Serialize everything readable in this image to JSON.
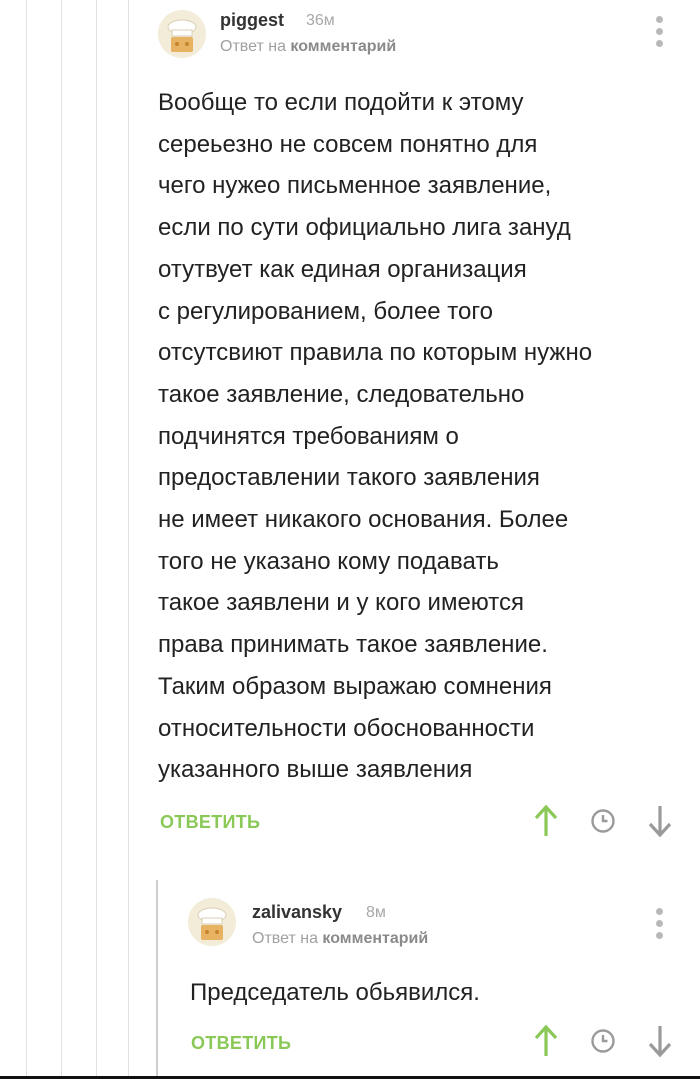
{
  "comments": [
    {
      "author": "piggest",
      "time": "36м",
      "reply_prefix": "Ответ на",
      "reply_target": "комментарий",
      "text": "Вообще то если подойти к этому\nсереьезно не совсем понятно для\nчего нужео письменное заявление,\nесли по сути официально лига зануд\nотутвует как единая организация\nс регулированием, более того\nотсутсвиют правила по которым нужно\nтакое заявление, следовательно\nподчинятся требованиям о\nпредоставлении такого заявления\nне имеет никакого основания. Более\nтого не указано кому подавать\nтакое заявлени и у кого имеются\nправа принимать такое заявление.\nТаким образом выражаю сомнения\nотносительности обоснованности\nуказанного выше заявления",
      "reply_label": "ОТВЕТИТЬ"
    },
    {
      "author": "zalivansky",
      "time": "8м",
      "reply_prefix": "Ответ на",
      "reply_target": "комментарий",
      "text": "Председатель обьявился.",
      "reply_label": "ОТВЕТИТЬ"
    }
  ],
  "icons": {
    "menu": "more-vertical-icon",
    "upvote": "arrow-up-icon",
    "save": "clock-icon",
    "downvote": "arrow-down-icon"
  },
  "colors": {
    "accent_green": "#8ac858",
    "icon_gray": "#9a9a9a",
    "muted_text": "#a0a0a0"
  }
}
